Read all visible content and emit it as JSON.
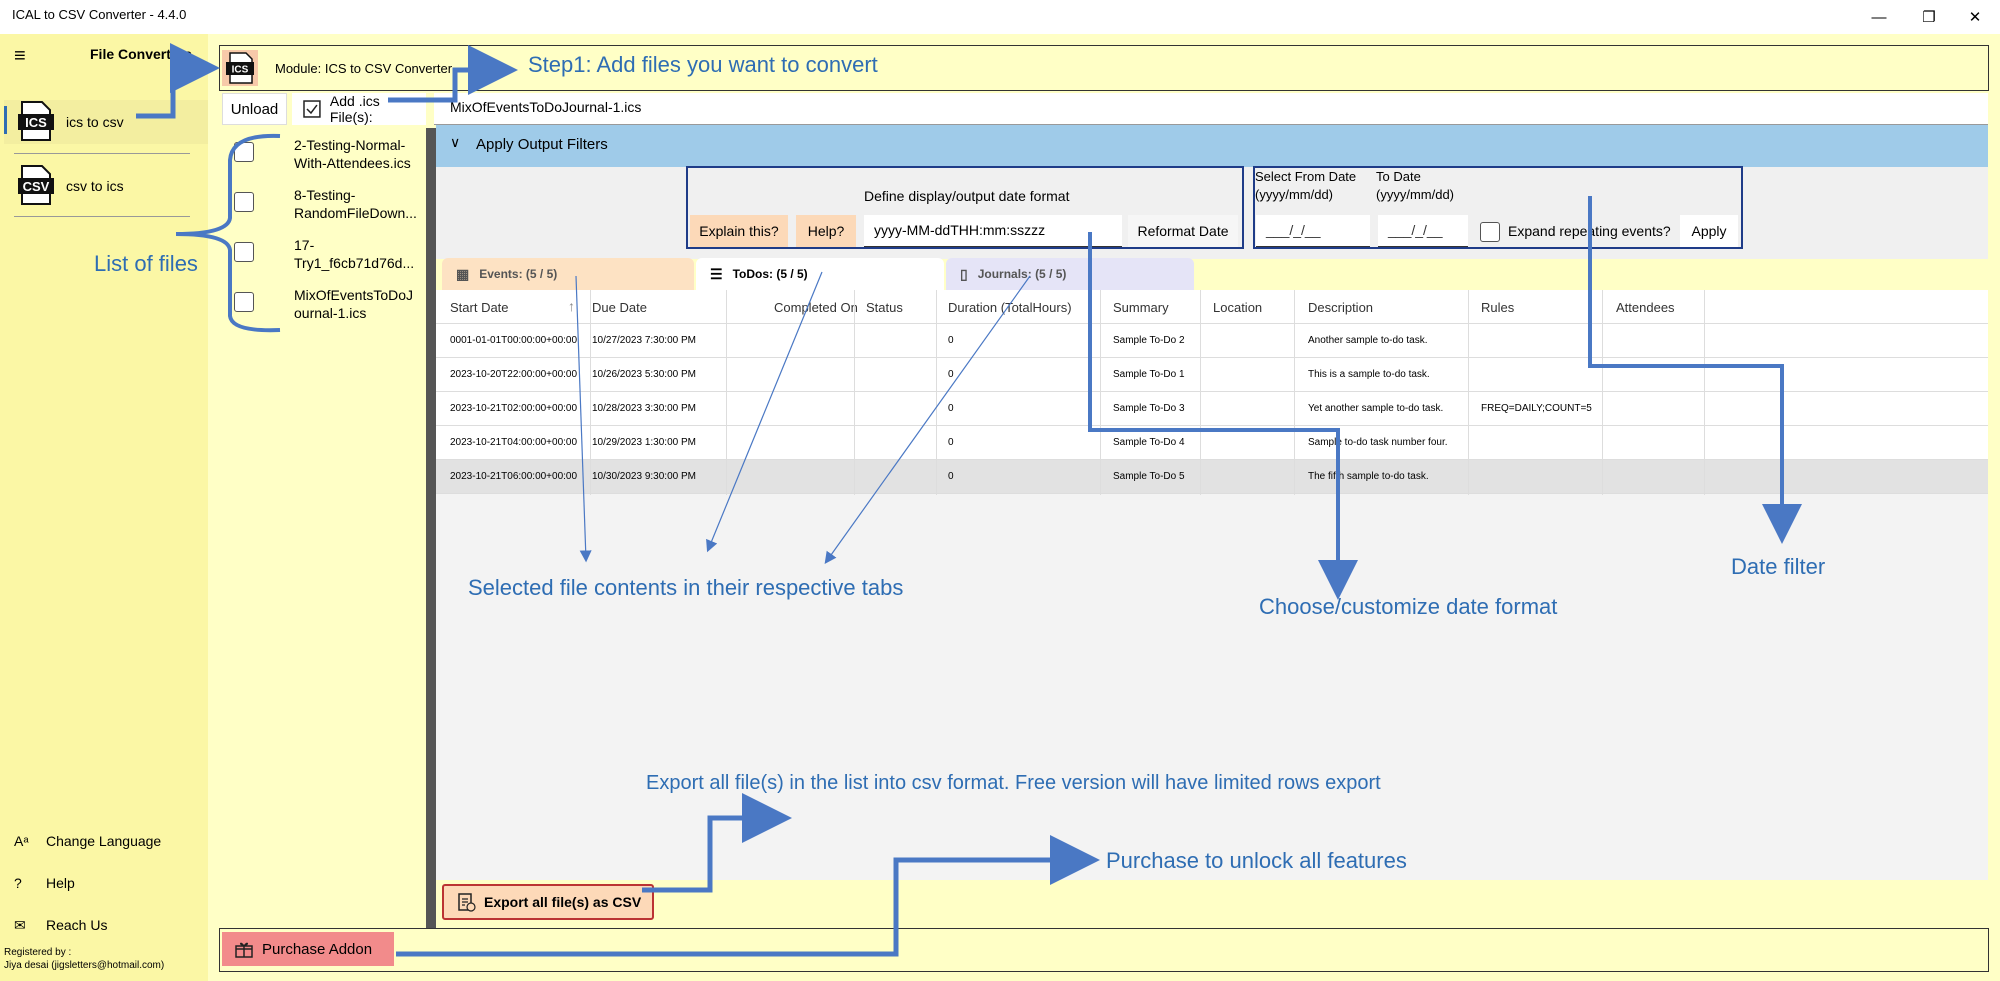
{
  "window": {
    "title": "ICAL to CSV Converter -  4.4.0",
    "minimize_glyph": "—",
    "restore_glyph": "❐",
    "close_glyph": "✕"
  },
  "sidebar": {
    "header": "File Converters",
    "items": [
      {
        "label": "ics to csv",
        "icon": "ics-file-icon",
        "icon_text": "ICS"
      },
      {
        "label": "csv to ics",
        "icon": "csv-file-icon",
        "icon_text": "CSV"
      }
    ],
    "bottom": [
      {
        "label": "Change Language",
        "icon": "language-icon",
        "glyph": "Aᵃ"
      },
      {
        "label": "Help",
        "icon": "help-icon",
        "glyph": "?"
      },
      {
        "label": "Reach Us",
        "icon": "mail-icon",
        "glyph": "✉"
      }
    ],
    "registered_label": "Registered by :",
    "registered_user": "Jiya desai (jigsletters@hotmail.com)"
  },
  "module": {
    "label": "Module: ICS to CSV Converter",
    "icon_text": "ICS"
  },
  "toolbar": {
    "unload_label": "Unload",
    "add_label": "Add .ics File(s):",
    "selected_file": "MixOfEventsToDoJournal-1.ics"
  },
  "files": [
    {
      "line1": "2-Testing-Normal-",
      "line2": "With-Attendees.ics"
    },
    {
      "line1": "8-Testing-",
      "line2": "RandomFileDown..."
    },
    {
      "line1": "17-",
      "line2": "Try1_f6cb71d76d..."
    },
    {
      "line1": "MixOfEventsToDoJ",
      "line2": "ournal-1.ics"
    }
  ],
  "filters": {
    "header": "Apply Output Filters",
    "date_format_label": "Define display/output date format",
    "explain_label": "Explain this?",
    "help_label": "Help?",
    "date_format_value": "yyyy-MM-ddTHH:mm:sszzz",
    "reformat_label": "Reformat Date",
    "from_label": "Select From Date",
    "to_label": "To Date",
    "date_hint_from": "(yyyy/mm/dd)",
    "date_hint_to": "(yyyy/mm/dd)",
    "from_placeholder": "___/_/__",
    "to_placeholder": "___/_/__",
    "expand_label": "Expand repeating events?",
    "apply_label": "Apply"
  },
  "tabs": [
    {
      "label": "Events: (5 / 5)",
      "icon": "calendar-icon",
      "color": "#fde2c3"
    },
    {
      "label": "ToDos: (5 / 5)",
      "icon": "checklist-icon",
      "color": "#ffffff"
    },
    {
      "label": "Journals: (5 / 5)",
      "icon": "journal-icon",
      "color": "#e5e4f7"
    }
  ],
  "grid": {
    "columns": [
      "Start Date",
      "Due Date",
      "Completed On",
      "Status",
      "Duration (TotalHours)",
      "Summary",
      "Location",
      "Description",
      "Rules",
      "Attendees"
    ],
    "rows": [
      [
        "0001-01-01T00:00:00+00:00",
        "10/27/2023 7:30:00 PM",
        "",
        "",
        "0",
        "Sample To-Do 2",
        "",
        "Another sample to-do task.",
        "",
        ""
      ],
      [
        "2023-10-20T22:00:00+00:00",
        "10/26/2023 5:30:00 PM",
        "",
        "",
        "0",
        "Sample To-Do 1",
        "",
        "This is a sample to-do task.",
        "",
        ""
      ],
      [
        "2023-10-21T02:00:00+00:00",
        "10/28/2023 3:30:00 PM",
        "",
        "",
        "0",
        "Sample To-Do 3",
        "",
        "Yet another sample to-do task.",
        "FREQ=DAILY;COUNT=5",
        ""
      ],
      [
        "2023-10-21T04:00:00+00:00",
        "10/29/2023 1:30:00 PM",
        "",
        "",
        "0",
        "Sample To-Do 4",
        "",
        "Sample to-do task number four.",
        "",
        ""
      ],
      [
        "2023-10-21T06:00:00+00:00",
        "10/30/2023 9:30:00 PM",
        "",
        "",
        "0",
        "Sample To-Do 5",
        "",
        "The fifth sample to-do task.",
        "",
        ""
      ]
    ],
    "sort_glyph": "↑"
  },
  "actions": {
    "export_label": "Export all file(s) as CSV",
    "purchase_label": "Purchase Addon"
  },
  "annotations": {
    "step1": "Step1: Add files you want to convert",
    "list_of_files": "List of files",
    "selected_contents": "Selected file contents in their respective tabs",
    "date_format": "Choose/customize date format",
    "date_filter": "Date filter",
    "export": "Export all file(s) in the list into csv format.  Free version will have limited rows export",
    "purchase": "Purchase to unlock all features",
    "color": "#2e6db3"
  }
}
